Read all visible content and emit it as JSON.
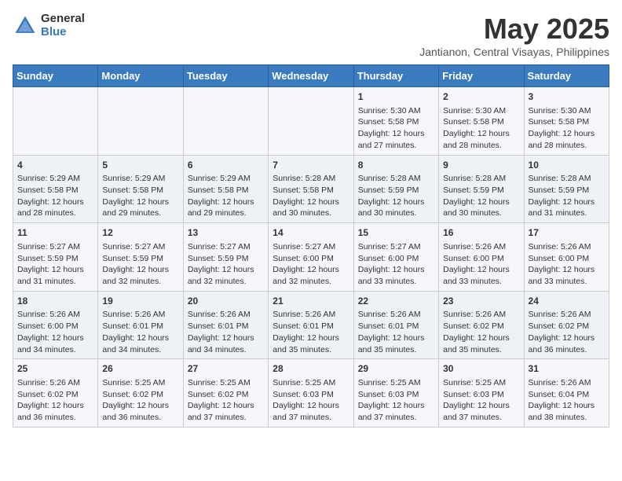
{
  "header": {
    "logo_general": "General",
    "logo_blue": "Blue",
    "title": "May 2025",
    "subtitle": "Jantianon, Central Visayas, Philippines"
  },
  "days_of_week": [
    "Sunday",
    "Monday",
    "Tuesday",
    "Wednesday",
    "Thursday",
    "Friday",
    "Saturday"
  ],
  "weeks": [
    [
      {
        "day": "",
        "info": ""
      },
      {
        "day": "",
        "info": ""
      },
      {
        "day": "",
        "info": ""
      },
      {
        "day": "",
        "info": ""
      },
      {
        "day": "1",
        "info": "Sunrise: 5:30 AM\nSunset: 5:58 PM\nDaylight: 12 hours\nand 27 minutes."
      },
      {
        "day": "2",
        "info": "Sunrise: 5:30 AM\nSunset: 5:58 PM\nDaylight: 12 hours\nand 28 minutes."
      },
      {
        "day": "3",
        "info": "Sunrise: 5:30 AM\nSunset: 5:58 PM\nDaylight: 12 hours\nand 28 minutes."
      }
    ],
    [
      {
        "day": "4",
        "info": "Sunrise: 5:29 AM\nSunset: 5:58 PM\nDaylight: 12 hours\nand 28 minutes."
      },
      {
        "day": "5",
        "info": "Sunrise: 5:29 AM\nSunset: 5:58 PM\nDaylight: 12 hours\nand 29 minutes."
      },
      {
        "day": "6",
        "info": "Sunrise: 5:29 AM\nSunset: 5:58 PM\nDaylight: 12 hours\nand 29 minutes."
      },
      {
        "day": "7",
        "info": "Sunrise: 5:28 AM\nSunset: 5:58 PM\nDaylight: 12 hours\nand 30 minutes."
      },
      {
        "day": "8",
        "info": "Sunrise: 5:28 AM\nSunset: 5:59 PM\nDaylight: 12 hours\nand 30 minutes."
      },
      {
        "day": "9",
        "info": "Sunrise: 5:28 AM\nSunset: 5:59 PM\nDaylight: 12 hours\nand 30 minutes."
      },
      {
        "day": "10",
        "info": "Sunrise: 5:28 AM\nSunset: 5:59 PM\nDaylight: 12 hours\nand 31 minutes."
      }
    ],
    [
      {
        "day": "11",
        "info": "Sunrise: 5:27 AM\nSunset: 5:59 PM\nDaylight: 12 hours\nand 31 minutes."
      },
      {
        "day": "12",
        "info": "Sunrise: 5:27 AM\nSunset: 5:59 PM\nDaylight: 12 hours\nand 32 minutes."
      },
      {
        "day": "13",
        "info": "Sunrise: 5:27 AM\nSunset: 5:59 PM\nDaylight: 12 hours\nand 32 minutes."
      },
      {
        "day": "14",
        "info": "Sunrise: 5:27 AM\nSunset: 6:00 PM\nDaylight: 12 hours\nand 32 minutes."
      },
      {
        "day": "15",
        "info": "Sunrise: 5:27 AM\nSunset: 6:00 PM\nDaylight: 12 hours\nand 33 minutes."
      },
      {
        "day": "16",
        "info": "Sunrise: 5:26 AM\nSunset: 6:00 PM\nDaylight: 12 hours\nand 33 minutes."
      },
      {
        "day": "17",
        "info": "Sunrise: 5:26 AM\nSunset: 6:00 PM\nDaylight: 12 hours\nand 33 minutes."
      }
    ],
    [
      {
        "day": "18",
        "info": "Sunrise: 5:26 AM\nSunset: 6:00 PM\nDaylight: 12 hours\nand 34 minutes."
      },
      {
        "day": "19",
        "info": "Sunrise: 5:26 AM\nSunset: 6:01 PM\nDaylight: 12 hours\nand 34 minutes."
      },
      {
        "day": "20",
        "info": "Sunrise: 5:26 AM\nSunset: 6:01 PM\nDaylight: 12 hours\nand 34 minutes."
      },
      {
        "day": "21",
        "info": "Sunrise: 5:26 AM\nSunset: 6:01 PM\nDaylight: 12 hours\nand 35 minutes."
      },
      {
        "day": "22",
        "info": "Sunrise: 5:26 AM\nSunset: 6:01 PM\nDaylight: 12 hours\nand 35 minutes."
      },
      {
        "day": "23",
        "info": "Sunrise: 5:26 AM\nSunset: 6:02 PM\nDaylight: 12 hours\nand 35 minutes."
      },
      {
        "day": "24",
        "info": "Sunrise: 5:26 AM\nSunset: 6:02 PM\nDaylight: 12 hours\nand 36 minutes."
      }
    ],
    [
      {
        "day": "25",
        "info": "Sunrise: 5:26 AM\nSunset: 6:02 PM\nDaylight: 12 hours\nand 36 minutes."
      },
      {
        "day": "26",
        "info": "Sunrise: 5:25 AM\nSunset: 6:02 PM\nDaylight: 12 hours\nand 36 minutes."
      },
      {
        "day": "27",
        "info": "Sunrise: 5:25 AM\nSunset: 6:02 PM\nDaylight: 12 hours\nand 37 minutes."
      },
      {
        "day": "28",
        "info": "Sunrise: 5:25 AM\nSunset: 6:03 PM\nDaylight: 12 hours\nand 37 minutes."
      },
      {
        "day": "29",
        "info": "Sunrise: 5:25 AM\nSunset: 6:03 PM\nDaylight: 12 hours\nand 37 minutes."
      },
      {
        "day": "30",
        "info": "Sunrise: 5:25 AM\nSunset: 6:03 PM\nDaylight: 12 hours\nand 37 minutes."
      },
      {
        "day": "31",
        "info": "Sunrise: 5:26 AM\nSunset: 6:04 PM\nDaylight: 12 hours\nand 38 minutes."
      }
    ]
  ]
}
